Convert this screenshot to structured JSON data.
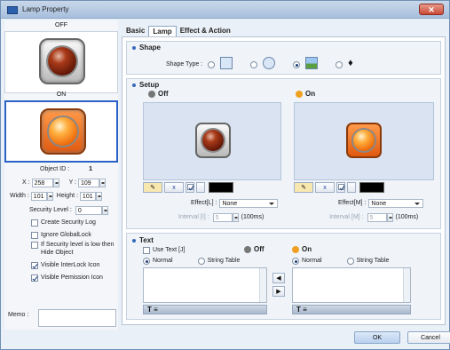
{
  "window": {
    "title": "Lamp Property"
  },
  "left": {
    "off_label": "OFF",
    "on_label": "ON",
    "object_id_label": "Object ID :",
    "object_id": "1",
    "x_label": "X :",
    "x_value": "258",
    "y_label": "Y :",
    "y_value": "109",
    "width_label": "Width :",
    "width_value": "101",
    "height_label": "Height :",
    "height_value": "101",
    "security_label": "Security Level :",
    "security_value": "0",
    "checkboxes": [
      {
        "label": "Create Security Log",
        "checked": false
      },
      {
        "label": "Ignore GlobalLock",
        "checked": false
      },
      {
        "label": "If Security level is low then Hide Object",
        "checked": false
      },
      {
        "label": "Visible InterLock Icon",
        "checked": true
      },
      {
        "label": "Visible Pemission Icon",
        "checked": true
      }
    ],
    "memo_label": "Memo :"
  },
  "tabs": [
    {
      "label": "Basic"
    },
    {
      "label": "Lamp"
    },
    {
      "label": "Effect & Action"
    }
  ],
  "shape": {
    "title": "Shape",
    "type_label": "Shape Type :"
  },
  "setup": {
    "title": "Setup",
    "off_label": "Off",
    "on_label": "On",
    "effect_l_label": "Effect[L] :",
    "effect_m_label": "Effect[M] :",
    "effect_value": "None",
    "interval_l_label": "Interval [I] :",
    "interval_m_label": "Interval [M] :",
    "interval_value": "5",
    "unit": "(100ms)",
    "x_btn": "x"
  },
  "text": {
    "title": "Text",
    "use_text_label": "Use Text [J]",
    "off_label": "Off",
    "on_label": "On",
    "normal_label": "Normal",
    "string_table_label": "String Table"
  },
  "buttons": {
    "ok": "OK",
    "cancel": "Cancel"
  },
  "colors": {
    "accent": "#3568b8",
    "on_state": "#f0a020",
    "off_state": "#777777"
  }
}
